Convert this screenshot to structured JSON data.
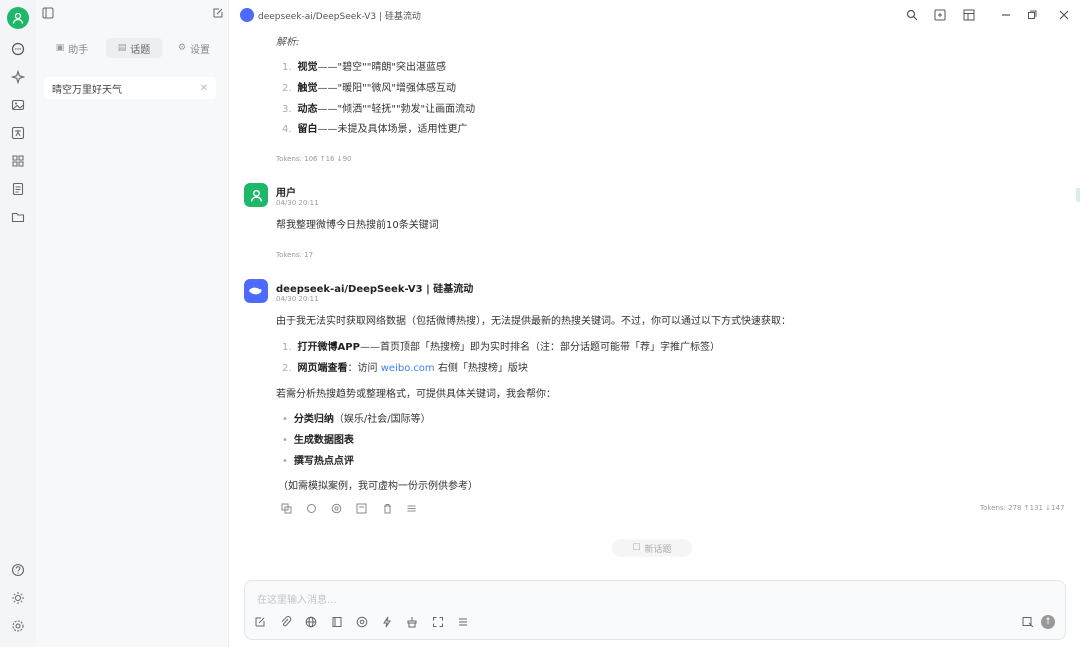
{
  "sidebar": {
    "tabs": [
      {
        "label": "助手",
        "icon": "robot-icon"
      },
      {
        "label": "话题",
        "icon": "chat-icon"
      },
      {
        "label": "设置",
        "icon": "gear-icon"
      }
    ],
    "topic": {
      "title": "晴空万里好天气"
    }
  },
  "header": {
    "title": "deepseek-ai/DeepSeek-V3 | 硅基流动"
  },
  "messages": {
    "prev": {
      "heading": "解析:",
      "items": [
        {
          "num": "1.",
          "bold": "视觉",
          "text": "——\"碧空\"\"晴朗\"突出湛蓝感"
        },
        {
          "num": "2.",
          "bold": "触觉",
          "text": "——\"暖阳\"\"微风\"增强体感互动"
        },
        {
          "num": "3.",
          "bold": "动态",
          "text": "——\"倾洒\"\"轻抚\"\"勃发\"让画面流动"
        },
        {
          "num": "4.",
          "bold": "留白",
          "text": "——未提及具体场景，适用性更广"
        }
      ],
      "tokens": "Tokens: 106 ↑16 ↓90"
    },
    "user": {
      "name": "用户",
      "time": "04/30 20:11",
      "text": "帮我整理微博今日热搜前10条关键词",
      "tokens": "Tokens: 17"
    },
    "assistant": {
      "name": "deepseek-ai/DeepSeek-V3 | 硅基流动",
      "time": "04/30 20:11",
      "intro": "由于我无法实时获取网络数据（包括微博热搜），无法提供最新的热搜关键词。不过，你可以通过以下方式快速获取：",
      "items": [
        {
          "num": "1.",
          "bold": "打开微博APP",
          "text": "——首页顶部「热搜榜」即为实时排名（注：部分话题可能带「荐」字推广标签）"
        },
        {
          "num": "2.",
          "bold": "网页端查看",
          "text_before": "：访问 ",
          "link": "weibo.com",
          "text_after": " 右侧「热搜榜」版块"
        }
      ],
      "follow": "若需分析热搜趋势或整理格式，可提供具体关键词，我会帮你：",
      "bullets": [
        "分类归纳",
        "生成数据图表",
        "撰写热点点评"
      ],
      "bullet1_tail": "（娱乐/社会/国际等）",
      "note": "（如需模拟案例，我可虚构一份示例供参考）",
      "tokens": "Tokens: 278 ↑131 ↓147"
    },
    "new_topic": "新话题"
  },
  "input": {
    "placeholder": "在这里输入消息..."
  },
  "colors": {
    "accent_green": "#1fb86a",
    "deepseek_blue": "#4d6bfe",
    "link": "#3b82f6"
  }
}
